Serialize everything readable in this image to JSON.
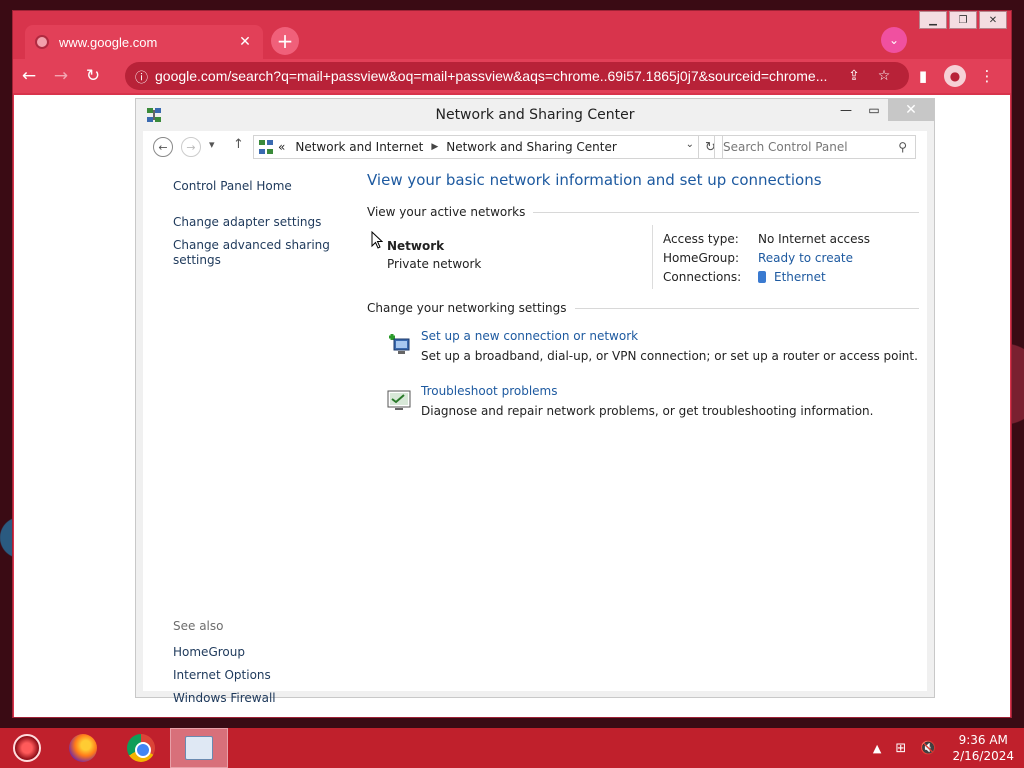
{
  "browser": {
    "tab_title": "www.google.com",
    "url": "google.com/search?q=mail+passview&oq=mail+passview&aqs=chrome..69i57.1865j0j7&sourceid=chrome..."
  },
  "window": {
    "title": "Network and Sharing Center"
  },
  "address": {
    "overflow": "«",
    "crumbs": [
      "Network and Internet",
      "Network and Sharing Center"
    ]
  },
  "search": {
    "placeholder": "Search Control Panel"
  },
  "left_pane": {
    "items": [
      "Control Panel Home",
      "Change adapter settings",
      "Change advanced sharing settings"
    ]
  },
  "see_also": {
    "heading": "See also",
    "items": [
      "HomeGroup",
      "Internet Options",
      "Windows Firewall"
    ]
  },
  "main": {
    "heading": "View your basic network information and set up connections",
    "active_networks_label": "View your active networks",
    "network_name": "Network",
    "network_type": "Private network",
    "props": {
      "access_type_label": "Access type:",
      "access_type_value": "No Internet access",
      "homegroup_label": "HomeGroup:",
      "homegroup_value": "Ready to create",
      "connections_label": "Connections:",
      "connections_value": "Ethernet"
    },
    "settings_label": "Change your networking settings",
    "tasks": [
      {
        "title": "Set up a new connection or network",
        "desc": "Set up a broadband, dial-up, or VPN connection; or set up a router or access point."
      },
      {
        "title": "Troubleshoot problems",
        "desc": "Diagnose and repair network problems, or get troubleshooting information."
      }
    ]
  },
  "taskbar": {
    "time": "9:36 AM",
    "date": "2/16/2024"
  },
  "colors": {
    "browser_accent": "#d8344c",
    "link": "#1e5aa0",
    "taskbar": "#c0202c"
  },
  "icons": {
    "tab_favicon": "globe-icon",
    "new_tab": "plus-icon",
    "tab_search": "chevron-down-icon",
    "back": "arrow-left-icon",
    "forward": "arrow-right-icon",
    "reload": "reload-icon",
    "site_info": "info-icon",
    "share": "share-icon",
    "bookmark": "star-icon",
    "side_panel": "side-panel-icon",
    "profile": "person-icon",
    "menu": "kebab-menu-icon",
    "search": "magnifier-icon",
    "ethernet": "ethernet-cable-icon"
  }
}
